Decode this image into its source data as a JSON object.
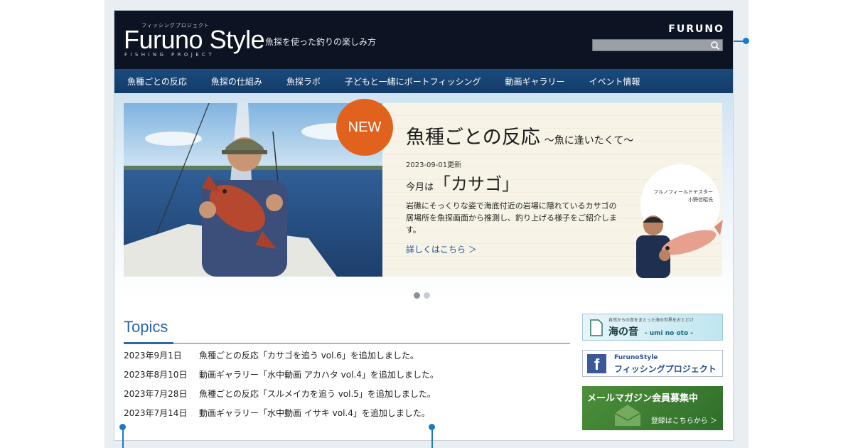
{
  "header": {
    "logo_kana": "フィッシングプロジェクト",
    "logo": "Furuno Style",
    "logo_sub": "FISHING PROJECT",
    "tagline": "魚探を使った釣りの楽しみ方",
    "brand": "FURUNO",
    "search_placeholder": "",
    "search_icon": "search-icon"
  },
  "nav": {
    "items": [
      "魚種ごとの反応",
      "魚探の仕組み",
      "魚探ラボ",
      "子どもと一緒にボートフィッシング",
      "動画ギャラリー",
      "イベント情報"
    ]
  },
  "hero": {
    "badge": "NEW",
    "title": "魚種ごとの反応",
    "title_sub": "～魚に逢いたくて～",
    "date": "2023-09-01更新",
    "month_prefix": "今月は",
    "month_fish": "「カサゴ」",
    "description": "岩礁にそっくりな姿で海底付近の岩場に隠れているカサゴの居場所を魚探画面から推測し、釣り上げる様子をご紹介します。",
    "more_link": "詳しくはこちら ＞",
    "tester_label_line1": "フルノフィールドテスター",
    "tester_label_line2": "小野信昭氏",
    "slides_total": 2,
    "slide_active": 1
  },
  "topics": {
    "title": "Topics",
    "items": [
      {
        "date": "2023年9月1日",
        "text": "魚種ごとの反応「カサゴを追う vol.6」を追加しました。"
      },
      {
        "date": "2023年8月10日",
        "text": "動画ギャラリー「水中動画 アカハタ vol.4」を追加しました。"
      },
      {
        "date": "2023年7月28日",
        "text": "魚種ごとの反応「スルメイカを追う vol.5」を追加しました。"
      },
      {
        "date": "2023年7月14日",
        "text": "動画ギャラリー「水中動画 イサキ vol.4」を追加しました。"
      }
    ]
  },
  "banners": {
    "umi_small": "自然からの音をまとった海の世界をおとどけ",
    "umi_title": "海の音",
    "umi_sub": "- umi no oto -",
    "fb_line1": "FurunoStyle",
    "fb_line2": "フィッシングプロジェクト",
    "mail_title": "メールマガジン会員募集中",
    "mail_link": "登録はこちらから ＞"
  },
  "colors": {
    "header_bg": "#0c1322",
    "nav_bg": "#1b4a7d",
    "accent_orange": "#e0621c",
    "topics_blue": "#2f67a8",
    "callout_blue": "#1c7ac4"
  }
}
